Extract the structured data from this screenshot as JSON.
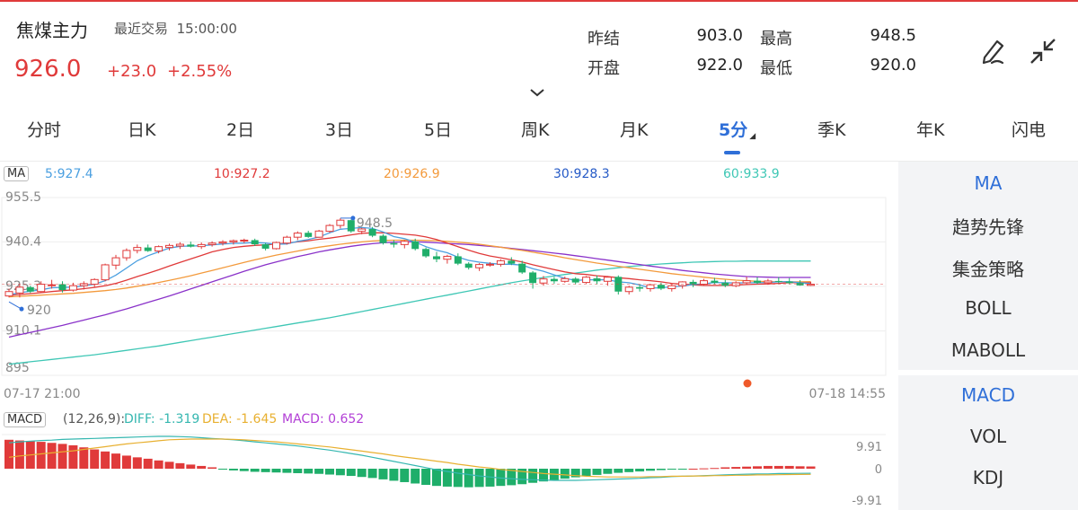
{
  "header": {
    "title": "焦煤主力",
    "last_trade_label": "最近交易",
    "last_trade_time": "15:00:00",
    "price": "926.0",
    "change": "+23.0",
    "change_pct": "+2.55%"
  },
  "quote": {
    "prev_close_label": "昨结",
    "prev_close": "903.0",
    "high_label": "最高",
    "high": "948.5",
    "open_label": "开盘",
    "open": "922.0",
    "low_label": "最低",
    "low": "920.0"
  },
  "icons": {
    "draw": "pen-icon",
    "collapse": "collapse-arrows-icon",
    "expand": "chevron-down-icon"
  },
  "tabs": [
    {
      "label": "分时"
    },
    {
      "label": "日K"
    },
    {
      "label": "2日"
    },
    {
      "label": "3日"
    },
    {
      "label": "5日"
    },
    {
      "label": "周K"
    },
    {
      "label": "月K"
    },
    {
      "label": "5分",
      "active": true
    },
    {
      "label": "季K"
    },
    {
      "label": "年K"
    },
    {
      "label": "闪电"
    }
  ],
  "ma_legend": {
    "tag": "MA",
    "ma5": "5:927.4",
    "ma10": "10:927.2",
    "ma20": "20:926.9",
    "ma30": "30:928.3",
    "ma60": "60:933.9"
  },
  "macd_legend": {
    "tag": "MACD",
    "params": "(12,26,9):",
    "diff": "DIFF: -1.319",
    "dea": "DEA: -1.645",
    "macd": "MACD: 0.652"
  },
  "side_main": [
    "MA",
    "趋势先锋",
    "集金策略",
    "BOLL",
    "MABOLL"
  ],
  "side_sub": [
    "MACD",
    "VOL",
    "KDJ"
  ],
  "colors": {
    "up": "#e03a3a",
    "down": "#1fae6a",
    "accent": "#2f6fd8",
    "ma5": "#4a9fe0",
    "ma10": "#e03a3a",
    "ma20": "#f39a3c",
    "ma30": "#8a32c9",
    "ma60": "#3fc7b5",
    "diff": "#35b7b0",
    "dea": "#e8b030",
    "macd_label": "#b23fd6"
  },
  "chart_data": [
    {
      "type": "candlestick",
      "interval": "5分",
      "y_ticks": [
        "955.5",
        "940.4",
        "925.3",
        "910.1",
        "895"
      ],
      "y_tick_values": [
        955.5,
        940.4,
        925.3,
        910.1,
        895
      ],
      "ylim": [
        895,
        955.5
      ],
      "x_start_label": "07-17 21:00",
      "x_end_label": "07-18 14:55",
      "annotations": {
        "high": "948.5",
        "low": "920"
      },
      "high_value": 948.5,
      "low_value": 920,
      "last_price": 926,
      "ohlc": [
        [
          922,
          924.5,
          921.5,
          923.5
        ],
        [
          923,
          926,
          921.5,
          925
        ],
        [
          925,
          925.5,
          923,
          923.5
        ],
        [
          923.5,
          927,
          923,
          926
        ],
        [
          925.5,
          927.5,
          924.5,
          925.8
        ],
        [
          926,
          927,
          923.2,
          924
        ],
        [
          924,
          926.5,
          923.5,
          925.5
        ],
        [
          925.5,
          927,
          924.2,
          926.2
        ],
        [
          926,
          928,
          925,
          927.6
        ],
        [
          927.5,
          933,
          927,
          932.6
        ],
        [
          932.5,
          936,
          931,
          935
        ],
        [
          935,
          938.2,
          934,
          937.5
        ],
        [
          937.5,
          939.5,
          936.5,
          938.5
        ],
        [
          938.5,
          939.5,
          937,
          937.3
        ],
        [
          937.3,
          939.2,
          936.5,
          938.8
        ],
        [
          938.5,
          939.8,
          937.5,
          939.2
        ],
        [
          939,
          940.3,
          938,
          939.6
        ],
        [
          939.5,
          940.5,
          938.5,
          938.8
        ],
        [
          938.8,
          940.2,
          938,
          939.5
        ],
        [
          939.5,
          940.6,
          938.8,
          940
        ],
        [
          940,
          941,
          939.2,
          940.4
        ],
        [
          940.4,
          941.2,
          939.5,
          940.8
        ],
        [
          940.8,
          941.5,
          940,
          941
        ],
        [
          941,
          941.5,
          939,
          939.6
        ],
        [
          939.6,
          940,
          937.5,
          938.1
        ],
        [
          938.1,
          940.5,
          937.8,
          940.2
        ],
        [
          940,
          942.5,
          939.5,
          942
        ],
        [
          942,
          944,
          941,
          943.4
        ],
        [
          943.5,
          944.2,
          941.8,
          942.1
        ],
        [
          942,
          944.5,
          941.8,
          944.1
        ],
        [
          944,
          946.5,
          943.5,
          946
        ],
        [
          946,
          948.5,
          945,
          947.8
        ],
        [
          947.8,
          948,
          943.5,
          944
        ],
        [
          944,
          945.2,
          943,
          944.8
        ],
        [
          944.8,
          945.5,
          942,
          942.5
        ],
        [
          942.5,
          943,
          939.5,
          940
        ],
        [
          940,
          941,
          938.5,
          939.5
        ],
        [
          939.5,
          941,
          938.2,
          940.6
        ],
        [
          940.6,
          941.5,
          937.5,
          938
        ],
        [
          938,
          938.5,
          935,
          935.5
        ],
        [
          935.5,
          937,
          933.5,
          934.5
        ],
        [
          934.5,
          936,
          933,
          935.5
        ],
        [
          935.5,
          936.5,
          932.5,
          933
        ],
        [
          933,
          933.5,
          931,
          931.6
        ],
        [
          931.6,
          933.2,
          930.5,
          932.7
        ],
        [
          932.7,
          933.5,
          932,
          932.8
        ],
        [
          932.8,
          934.5,
          932,
          934
        ],
        [
          934,
          935.2,
          932.5,
          933
        ],
        [
          933,
          934,
          929.5,
          930
        ],
        [
          930,
          930.5,
          924.5,
          926.4
        ],
        [
          926.4,
          928.8,
          925.5,
          927.8
        ],
        [
          927.8,
          928.5,
          926.2,
          927
        ],
        [
          927,
          928.6,
          926.5,
          927.9
        ],
        [
          927.9,
          928.4,
          926,
          926.6
        ],
        [
          926.6,
          928.8,
          926.2,
          928.4
        ],
        [
          928,
          929,
          926,
          927
        ],
        [
          927,
          928.8,
          925.5,
          928.4
        ],
        [
          928.5,
          929,
          922.5,
          923.5
        ],
        [
          923.5,
          925.5,
          922.5,
          925
        ],
        [
          925,
          925.8,
          923.5,
          924.5
        ],
        [
          924.5,
          926,
          923.5,
          925.8
        ],
        [
          925.8,
          926.5,
          924,
          924.5
        ],
        [
          924.5,
          926,
          923.5,
          925.5
        ],
        [
          925.5,
          927,
          924.5,
          926.8
        ],
        [
          926.8,
          927.5,
          925,
          926
        ],
        [
          926,
          927.8,
          925.5,
          927.2
        ],
        [
          927.2,
          928.2,
          926,
          926.5
        ],
        [
          926.5,
          927.5,
          925,
          925.5
        ],
        [
          925.5,
          927,
          925,
          926.5
        ],
        [
          926.5,
          928.5,
          925.8,
          927.2
        ],
        [
          927.2,
          928.4,
          926,
          926.5
        ],
        [
          926.5,
          927.8,
          925.8,
          927.1
        ],
        [
          927.1,
          928.4,
          926.3,
          926.9
        ],
        [
          926.9,
          928.1,
          926,
          926.4
        ],
        [
          926.4,
          927.4,
          925.5,
          925.6
        ],
        [
          925.6,
          926.8,
          925.4,
          926
        ]
      ],
      "ma5": [
        922.4,
        923.1,
        923.6,
        924.1,
        924.8,
        924.9,
        925.0,
        925.5,
        926.0,
        927.2,
        929.1,
        931.5,
        934.0,
        935.7,
        937.0,
        938.3,
        938.9,
        939.0,
        939.1,
        939.4,
        939.7,
        939.9,
        940.0,
        940.2,
        940.0,
        939.6,
        939.7,
        940.6,
        941.2,
        942.1,
        943.5,
        944.7,
        945.0,
        945.3,
        945.0,
        943.8,
        942.2,
        941.5,
        940.3,
        938.8,
        937.6,
        936.7,
        935.2,
        934.1,
        933.5,
        933.1,
        932.8,
        932.8,
        932.5,
        931.3,
        930.4,
        929.2,
        928.0,
        927.3,
        927.5,
        927.5,
        927.5,
        926.8,
        926.5,
        925.8,
        924.7,
        924.8,
        925.1,
        925.4,
        925.9,
        926.1,
        926.6,
        926.5,
        926.4,
        926.5,
        926.5,
        926.6,
        926.8,
        926.9,
        926.5,
        926.2
      ],
      "ma10": [
        922.2,
        922.5,
        922.8,
        923.1,
        923.5,
        923.8,
        924.1,
        924.5,
        924.9,
        925.5,
        926.3,
        927.4,
        928.6,
        929.7,
        930.9,
        932.2,
        933.4,
        934.6,
        935.8,
        937.0,
        937.8,
        938.5,
        938.9,
        939.2,
        939.4,
        939.7,
        940.0,
        940.4,
        940.8,
        941.3,
        941.7,
        942.2,
        942.8,
        943.3,
        943.5,
        943.5,
        943.3,
        943.0,
        942.7,
        942.1,
        941.2,
        940.0,
        938.8,
        937.6,
        936.5,
        935.6,
        935.0,
        934.3,
        933.6,
        932.6,
        931.8,
        931.0,
        930.2,
        929.6,
        929.3,
        928.9,
        928.6,
        928.2,
        927.9,
        927.5,
        927.2,
        926.8,
        926.3,
        926.0,
        925.8,
        925.6,
        925.6,
        925.6,
        925.7,
        925.9,
        926.0,
        926.1,
        926.3,
        926.5,
        926.5,
        926.5
      ],
      "ma20": [
        921.7,
        921.9,
        922.1,
        922.3,
        922.5,
        922.7,
        922.9,
        923.2,
        923.5,
        923.8,
        924.2,
        924.7,
        925.3,
        925.9,
        926.6,
        927.3,
        928.1,
        928.9,
        929.8,
        930.7,
        931.6,
        932.5,
        933.4,
        934.3,
        935.1,
        935.9,
        936.6,
        937.3,
        938.0,
        938.6,
        939.1,
        939.6,
        940.0,
        940.4,
        940.7,
        940.9,
        941.0,
        941.0,
        941.0,
        940.9,
        940.8,
        940.6,
        940.3,
        940.0,
        939.6,
        939.1,
        938.6,
        938.0,
        937.5,
        936.9,
        936.3,
        935.7,
        935.0,
        934.4,
        933.8,
        933.2,
        932.7,
        932.1,
        931.6,
        931.1,
        930.6,
        930.1,
        929.6,
        929.2,
        928.8,
        928.4,
        928.0,
        927.7,
        927.4,
        927.2,
        927.0,
        926.9,
        926.8,
        926.8,
        926.8,
        926.9
      ],
      "ma30": [
        908.0,
        908.8,
        909.6,
        910.4,
        911.2,
        912.0,
        912.9,
        913.8,
        914.7,
        915.6,
        916.6,
        917.6,
        918.7,
        919.8,
        920.9,
        922.0,
        923.2,
        924.4,
        925.6,
        926.8,
        928.0,
        929.2,
        930.4,
        931.5,
        932.6,
        933.6,
        934.5,
        935.4,
        936.2,
        937.0,
        937.7,
        938.3,
        938.9,
        939.4,
        939.8,
        940.1,
        940.3,
        940.4,
        940.4,
        940.3,
        940.1,
        939.9,
        939.7,
        939.5,
        939.2,
        938.9,
        938.6,
        938.2,
        937.8,
        937.4,
        937.0,
        936.6,
        936.2,
        935.7,
        935.2,
        934.7,
        934.2,
        933.7,
        933.2,
        932.7,
        932.2,
        931.7,
        931.2,
        930.7,
        930.3,
        929.9,
        929.5,
        929.2,
        928.9,
        928.6,
        928.5,
        928.4,
        928.3,
        928.3,
        928.3,
        928.3
      ],
      "ma60": [
        898.8,
        899.2,
        899.6,
        900.0,
        900.4,
        900.8,
        901.2,
        901.6,
        902.0,
        902.5,
        903.0,
        903.5,
        904.0,
        904.5,
        905.0,
        905.6,
        906.2,
        906.8,
        907.4,
        908.0,
        908.6,
        909.2,
        909.8,
        910.4,
        911.0,
        911.6,
        912.2,
        912.8,
        913.4,
        914.0,
        914.6,
        915.3,
        916.0,
        916.7,
        917.4,
        918.1,
        918.8,
        919.5,
        920.2,
        920.9,
        921.6,
        922.3,
        923.0,
        923.7,
        924.4,
        925.1,
        925.8,
        926.5,
        927.1,
        927.7,
        928.3,
        928.8,
        929.3,
        929.8,
        930.3,
        930.8,
        931.2,
        931.6,
        932.0,
        932.3,
        932.6,
        932.9,
        933.1,
        933.3,
        933.5,
        933.6,
        933.7,
        933.8,
        933.8,
        933.9,
        933.9,
        933.9,
        933.9,
        933.9,
        933.9,
        933.9
      ]
    },
    {
      "type": "bar",
      "indicator": "MACD",
      "y_ticks": [
        "9.91",
        "0",
        "-9.91"
      ],
      "y_tick_values": [
        9.91,
        0,
        -9.91
      ],
      "ylim": [
        -9.91,
        9.91
      ],
      "macd": [
        8.4,
        8.2,
        8.0,
        7.8,
        7.5,
        7.2,
        6.8,
        6.2,
        5.6,
        5.0,
        4.4,
        3.8,
        3.3,
        2.9,
        2.4,
        2.0,
        1.6,
        1.2,
        0.8,
        0.4,
        -0.2,
        -0.5,
        -0.7,
        -0.9,
        -1.0,
        -1.1,
        -1.2,
        -1.3,
        -1.4,
        -1.5,
        -1.7,
        -1.9,
        -2.1,
        -2.4,
        -2.7,
        -3.1,
        -3.5,
        -3.9,
        -4.3,
        -4.7,
        -5.0,
        -5.2,
        -5.3,
        -5.4,
        -5.3,
        -5.2,
        -5.0,
        -4.8,
        -4.5,
        -4.1,
        -3.7,
        -3.3,
        -2.9,
        -2.5,
        -2.1,
        -1.8,
        -1.5,
        -1.2,
        -1.0,
        -0.8,
        -0.6,
        -0.4,
        -0.2,
        -0.1,
        0.0,
        0.1,
        0.2,
        0.4,
        0.5,
        0.6,
        0.7,
        0.8,
        0.8,
        0.8,
        0.7,
        0.65
      ],
      "diff": [
        7.5,
        7.8,
        8.0,
        8.2,
        8.3,
        8.5,
        8.6,
        8.7,
        8.8,
        8.9,
        9.0,
        9.1,
        9.2,
        9.3,
        9.4,
        9.4,
        9.3,
        9.2,
        9.0,
        8.8,
        8.6,
        8.4,
        8.1,
        7.8,
        7.5,
        7.2,
        6.9,
        6.6,
        6.2,
        5.8,
        5.4,
        4.9,
        4.4,
        3.9,
        3.3,
        2.7,
        2.1,
        1.5,
        0.9,
        0.3,
        -0.3,
        -0.8,
        -1.3,
        -1.7,
        -2.1,
        -2.4,
        -2.7,
        -2.9,
        -3.1,
        -3.2,
        -3.3,
        -3.4,
        -3.4,
        -3.4,
        -3.3,
        -3.2,
        -3.1,
        -3.0,
        -2.9,
        -2.8,
        -2.6,
        -2.5,
        -2.3,
        -2.2,
        -2.1,
        -2.0,
        -1.9,
        -1.8,
        -1.7,
        -1.6,
        -1.5,
        -1.5,
        -1.4,
        -1.4,
        -1.35,
        -1.319
      ],
      "dea": [
        3.3,
        3.7,
        4.0,
        4.3,
        4.6,
        4.9,
        5.2,
        5.6,
        6.0,
        6.4,
        6.8,
        7.2,
        7.5,
        7.8,
        8.1,
        8.4,
        8.5,
        8.6,
        8.6,
        8.6,
        8.6,
        8.5,
        8.4,
        8.2,
        8.0,
        7.8,
        7.5,
        7.2,
        6.9,
        6.6,
        6.3,
        5.9,
        5.5,
        5.1,
        4.7,
        4.3,
        3.8,
        3.4,
        3.0,
        2.6,
        2.2,
        1.8,
        1.3,
        0.9,
        0.5,
        0.2,
        -0.2,
        -0.5,
        -0.8,
        -1.1,
        -1.4,
        -1.6,
        -1.8,
        -2.0,
        -2.2,
        -2.3,
        -2.4,
        -2.4,
        -2.4,
        -2.4,
        -2.3,
        -2.3,
        -2.2,
        -2.2,
        -2.1,
        -2.1,
        -2.0,
        -2.0,
        -1.9,
        -1.9,
        -1.8,
        -1.8,
        -1.75,
        -1.7,
        -1.67,
        -1.645
      ]
    }
  ]
}
